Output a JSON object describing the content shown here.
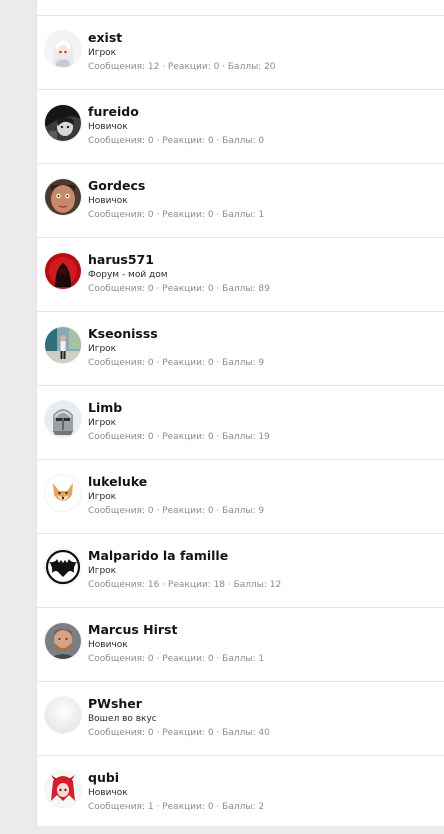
{
  "members": [
    {
      "name": "exist",
      "title": "Игрок",
      "stats": "Сообщения: 12 · Реакции: 0 · Баллы: 20",
      "avatar_icon": "anime-white-hair-avatar-icon"
    },
    {
      "name": "fureido",
      "title": "Новичок",
      "stats": "Сообщения: 0 · Реакции: 0 · Баллы: 0",
      "avatar_icon": "dark-anime-avatar-icon"
    },
    {
      "name": "Gordecs",
      "title": "Новичок",
      "stats": "Сообщения: 0 · Реакции: 0 · Баллы: 1",
      "avatar_icon": "face-photo-avatar-icon"
    },
    {
      "name": "harus571",
      "title": "Форум - мой дом",
      "stats": "Сообщения: 0 · Реакции: 0 · Баллы: 89",
      "avatar_icon": "red-hooded-figure-avatar-icon"
    },
    {
      "name": "Kseonisss",
      "title": "Игрок",
      "stats": "Сообщения: 0 · Реакции: 0 · Баллы: 9",
      "avatar_icon": "person-standing-avatar-icon"
    },
    {
      "name": "Limb",
      "title": "Игрок",
      "stats": "Сообщения: 0 · Реакции: 0 · Баллы: 19",
      "avatar_icon": "knight-helmet-avatar-icon"
    },
    {
      "name": "lukeluke",
      "title": "Игрок",
      "stats": "Сообщения: 0 · Реакции: 0 · Баллы: 9",
      "avatar_icon": "fox-avatar-icon"
    },
    {
      "name": "Malparido la famille",
      "title": "Игрок",
      "stats": "Сообщения: 16 · Реакции: 18 · Баллы: 12",
      "avatar_icon": "bat-logo-avatar-icon"
    },
    {
      "name": "Marcus Hirst",
      "title": "Новичок",
      "stats": "Сообщения: 0 · Реакции: 0 · Баллы: 1",
      "avatar_icon": "man-photo-avatar-icon"
    },
    {
      "name": "PWsher",
      "title": "Вошел во вкус",
      "stats": "Сообщения: 0 · Реакции: 0 · Баллы: 40",
      "avatar_icon": "blank-white-avatar-icon"
    },
    {
      "name": "qubi",
      "title": "Новичок",
      "stats": "Сообщения: 1 · Реакции: 0 · Баллы: 2",
      "avatar_icon": "red-anime-avatar-icon"
    }
  ]
}
